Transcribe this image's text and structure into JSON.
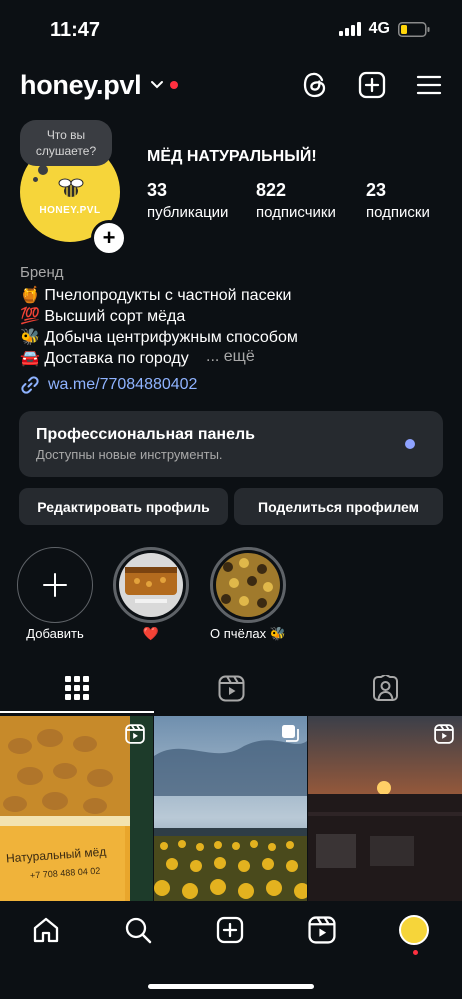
{
  "status_bar": {
    "time": "11:47",
    "network": "4G"
  },
  "header": {
    "username": "honey.pvl",
    "icons": [
      "chevron-down-icon",
      "threads-icon",
      "create-post-icon",
      "menu-icon"
    ],
    "notification_color": "#ff3040"
  },
  "profile": {
    "note": "Что вы слушаете?",
    "avatar_brand": "HONEY.PVL",
    "display_name": "МЁД НАТУРАЛЬНЫЙ!",
    "stats": [
      {
        "value": "33",
        "label": "публикации"
      },
      {
        "value": "822",
        "label": "подписчики"
      },
      {
        "value": "23",
        "label": "подписки"
      }
    ],
    "category": "Бренд",
    "bio": [
      "🍯 Пчелопродукты с частной пасеки",
      "💯 Высший сорт мёда",
      "🐝 Добыча центрифужным способом",
      "🚘 Доставка по городу"
    ],
    "more": "... ещё",
    "link": "wa.me/77084880402"
  },
  "pro_panel": {
    "title": "Профессиональная панель",
    "subtitle": "Доступны новые инструменты.",
    "dot_color": "#8ea2ff"
  },
  "buttons": {
    "edit": "Редактировать профиль",
    "share": "Поделиться профилем"
  },
  "highlights": [
    {
      "label": "Добавить"
    },
    {
      "label": "❤️"
    },
    {
      "label": "О пчёлах 🐝"
    }
  ],
  "tabs": [
    "grid-icon",
    "reels-icon",
    "tagged-icon"
  ],
  "grid": {
    "post1_caption": "Натуральный мёд",
    "post1_phone": "+7 708 488 04 02"
  },
  "bottom_nav": [
    "home-icon",
    "search-icon",
    "create-icon",
    "reels-icon",
    "profile-avatar"
  ]
}
